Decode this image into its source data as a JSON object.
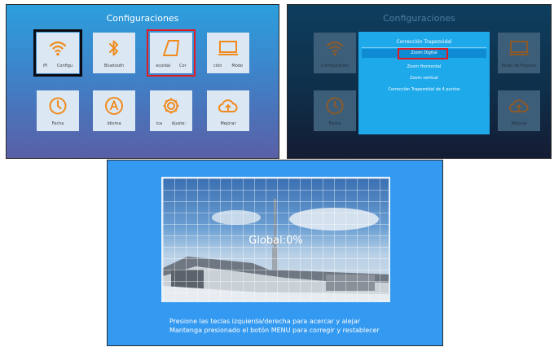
{
  "screen1": {
    "title": "Configuraciones",
    "tiles": [
      {
        "icon": "wifi-icon",
        "label_left": "iFi",
        "label_right": "Configu"
      },
      {
        "icon": "bluetooth-icon",
        "label": "Bluetooth"
      },
      {
        "icon": "keystone-icon",
        "label_left": "ecoidal",
        "label_right": "Cor"
      },
      {
        "icon": "screen-icon",
        "label_left": "ción",
        "label_right": "Modo"
      },
      {
        "icon": "clock-icon",
        "label": "Fecha"
      },
      {
        "icon": "language-icon",
        "label": "Idioma"
      },
      {
        "icon": "gear-icon",
        "label_left": "ica",
        "label_right": "Ajuste:"
      },
      {
        "icon": "cloud-upgrade-icon",
        "label": "Mejorar"
      }
    ]
  },
  "screen2": {
    "title": "Configuraciones",
    "bg_tiles": [
      {
        "icon": "wifi-icon",
        "label": "Configuración"
      },
      {
        "icon": "screen-icon",
        "label": "Modo de Proyecc"
      },
      {
        "icon": "clock-icon",
        "label": "Fecha"
      },
      {
        "icon": "cloud-upgrade-icon",
        "label": "Mejorar"
      }
    ],
    "menu": {
      "title": "Corrección Trapezoidal",
      "items": [
        "Zoom Digital",
        "Zoom Horizontal",
        "Zoom vertical",
        "Corrección Trapezoidal de 4 puntos"
      ]
    }
  },
  "screen3": {
    "overlay_text": "Global:0%",
    "instructions": [
      "Presione las teclas izquierda/derecha para acercar y alejar",
      "Mantenga presionado el botón MENU para corregir y restablecer"
    ]
  },
  "colors": {
    "accent_orange": "#f08a1c",
    "focus_red": "#e21b23",
    "menu_blue": "#1ea9ea",
    "menu_highlight": "#0f8bd3",
    "zoom_bg": "#3399f1"
  }
}
